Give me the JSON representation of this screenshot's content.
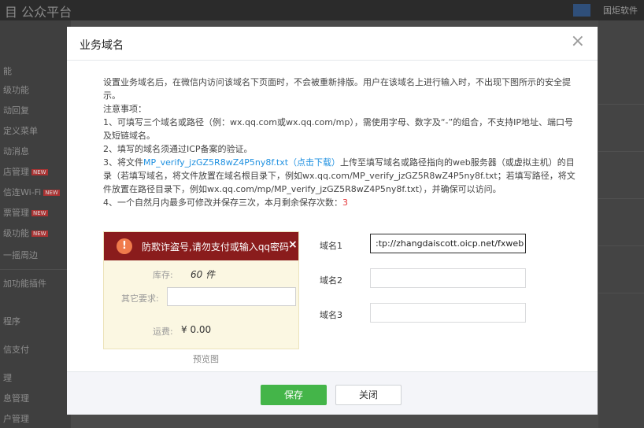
{
  "background": {
    "app_title": "目 公众平台",
    "account_name": "国炬软件",
    "sidebar": [
      "能",
      "级功能",
      "动回复",
      "定义菜单",
      "动消息",
      "店管理",
      "信连Wi-Fi",
      "票管理",
      "级功能",
      "一摇周边",
      "加功能插件",
      "程序",
      "信支付",
      "理",
      "息管理",
      "户管理"
    ],
    "badge": "NEW"
  },
  "modal": {
    "title": "业务域名",
    "close_icon": "×",
    "desc": {
      "p1": "设置业务域名后，在微信内访问该域名下页面时，不会被重新排版。用户在该域名上进行输入时，不出现下图所示的安全提示。",
      "p2": "注意事项：",
      "p3": "1、可填写三个域名或路径（例：wx.qq.com或wx.qq.com/mp），需使用字母、数字及“-”的组合，不支持IP地址、端口号及短链域名。",
      "p4": "2、填写的域名须通过ICP备案的验证。",
      "p5_a": "3、将文件",
      "p5_file": "MP_verify_jzGZ5R8wZ4P5ny8f.txt",
      "p5_download": "（点击下载）",
      "p5_b": "上传至填写域名或路径指向的web服务器（或虚拟主机）的目录（若填写域名，将文件放置在域名根目录下，例如wx.qq.com/MP_verify_jzGZ5R8wZ4P5ny8f.txt；若填写路径，将文件放置在路径目录下，例如wx.qq.com/mp/MP_verify_jzGZ5R8wZ4P5ny8f.txt），并确保可以访问。",
      "p6_a": "4、一个自然月内最多可修改并保存三次，本月剩余保存次数：",
      "p6_count": "3"
    },
    "preview": {
      "warning_icon": "!",
      "warning": "防欺诈盗号,请勿支付或输入qq密码",
      "warning_close": "×",
      "stock_label": "库存:",
      "stock_value": "60 件",
      "other_label": "其它要求:",
      "shipping_label": "运费:",
      "shipping_value": "¥ 0.00",
      "caption": "预览图"
    },
    "domains": [
      {
        "label": "域名1",
        "value": ":tp://zhangdaiscott.oicp.net/fxweb"
      },
      {
        "label": "域名2",
        "value": ""
      },
      {
        "label": "域名3",
        "value": ""
      }
    ],
    "buttons": {
      "save": "保存",
      "close": "关闭"
    },
    "colors": {
      "primary": "#44b549",
      "link": "#1e90e0",
      "warning": "#8a1c1c",
      "count": "#e5383b"
    }
  }
}
